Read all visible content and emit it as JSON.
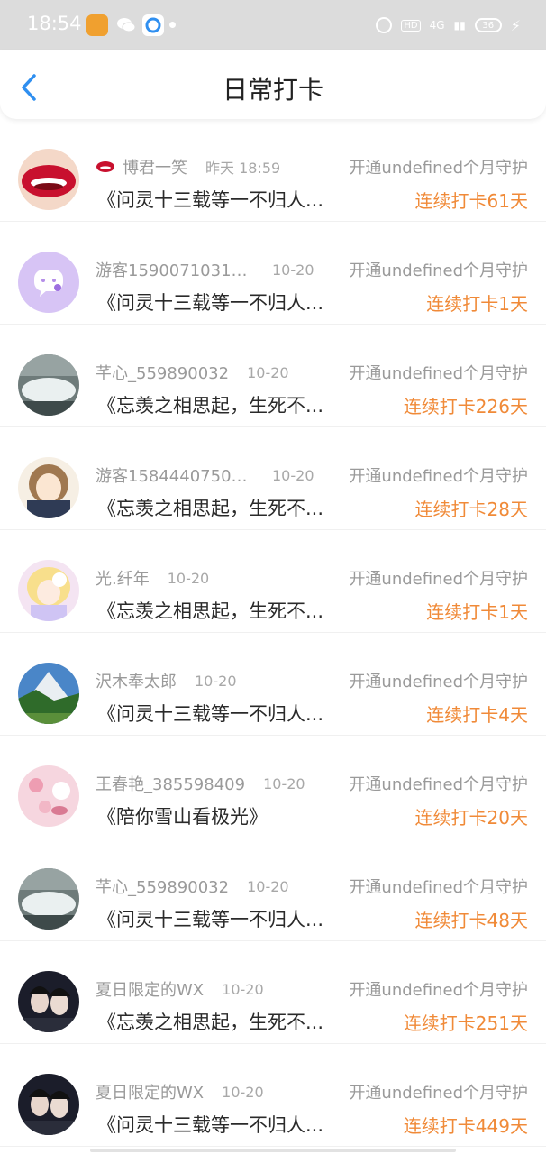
{
  "status_bar": {
    "time": "18:54",
    "hd": "HD",
    "signal": "4G",
    "battery": "36"
  },
  "header": {
    "title": "日常打卡"
  },
  "colors": {
    "accent_blue": "#2f8ff0",
    "streak_orange": "#f08a38",
    "muted_gray": "#9a9a9a"
  },
  "items": [
    {
      "name": "博君一笑",
      "date": "昨天 18:59",
      "guard": "开通undefined个月守护",
      "work": "《问灵十三载等一不归人...",
      "streak": "连续打卡61天",
      "avatar_icon": "red-lips-avatar",
      "has_badge": true
    },
    {
      "name": "游客15900710318...",
      "date": "10-20",
      "guard": "开通undefined个月守护",
      "work": "《问灵十三载等一不归人...",
      "streak": "连续打卡1天",
      "avatar_icon": "purple-chat-avatar"
    },
    {
      "name": "芊心_559890032",
      "date": "10-20",
      "guard": "开通undefined个月守护",
      "work": "《忘羡之相思起，生死不...",
      "streak": "连续打卡226天",
      "avatar_icon": "waterfall-avatar"
    },
    {
      "name": "游客15844407500...",
      "date": "10-20",
      "guard": "开通undefined个月守护",
      "work": "《忘羡之相思起，生死不...",
      "streak": "连续打卡28天",
      "avatar_icon": "anime-girl-avatar"
    },
    {
      "name": "光.纤年",
      "date": "10-20",
      "guard": "开通undefined个月守护",
      "work": "《忘羡之相思起，生死不...",
      "streak": "连续打卡1天",
      "avatar_icon": "anime-blonde-avatar"
    },
    {
      "name": "沢木奉太郎",
      "date": "10-20",
      "guard": "开通undefined个月守护",
      "work": "《问灵十三载等一不归人...",
      "streak": "连续打卡4天",
      "avatar_icon": "mountain-avatar"
    },
    {
      "name": "王春艳_385598409",
      "date": "10-20",
      "guard": "开通undefined个月守护",
      "work": "《陪你雪山看极光》",
      "streak": "连续打卡20天",
      "avatar_icon": "pink-flower-avatar"
    },
    {
      "name": "芊心_559890032",
      "date": "10-20",
      "guard": "开通undefined个月守护",
      "work": "《问灵十三载等一不归人...",
      "streak": "连续打卡48天",
      "avatar_icon": "waterfall-avatar"
    },
    {
      "name": "夏日限定的WX",
      "date": "10-20",
      "guard": "开通undefined个月守护",
      "work": "《忘羡之相思起，生死不...",
      "streak": "连续打卡251天",
      "avatar_icon": "duo-portrait-avatar"
    },
    {
      "name": "夏日限定的WX",
      "date": "10-20",
      "guard": "开通undefined个月守护",
      "work": "《问灵十三载等一不归人...",
      "streak": "连续打卡449天",
      "avatar_icon": "duo-portrait-avatar"
    }
  ]
}
